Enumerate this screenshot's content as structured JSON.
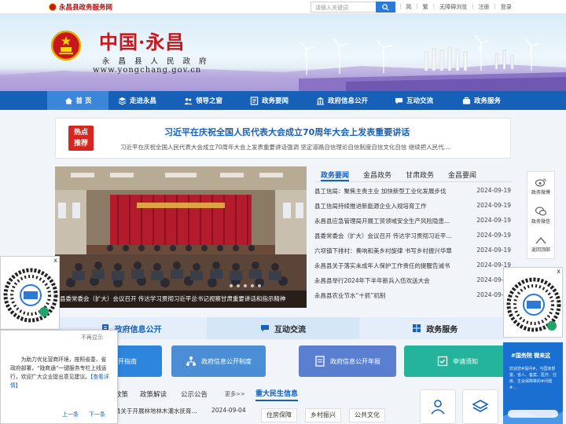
{
  "topbar": {
    "site_name": "永昌县政务服务网",
    "search_placeholder": "请输入关键词",
    "links": [
      "简",
      "繁",
      "无障碍浏览",
      "注册",
      "登录"
    ]
  },
  "banner": {
    "title": "中国·永昌",
    "subtitle": "永 昌 县 人 民 政 府",
    "url": "www.yongchang.gov.cn"
  },
  "nav": {
    "items": [
      {
        "label": "首 页",
        "icon": "home-icon"
      },
      {
        "label": "走进永昌",
        "icon": "layers-icon"
      },
      {
        "label": "领导之窗",
        "icon": "users-icon"
      },
      {
        "label": "政务要闻",
        "icon": "news-icon"
      },
      {
        "label": "政府信息公开",
        "icon": "building-icon"
      },
      {
        "label": "互动交流",
        "icon": "chat-icon"
      },
      {
        "label": "政务服务",
        "icon": "briefcase-icon"
      }
    ]
  },
  "hot": {
    "badge_line1": "热点",
    "badge_line2": "推荐",
    "headline": "习近平在庆祝全国人民代表大会成立70周年大会上发表重要讲话",
    "summary": "习近平在庆祝全国人民代表大会成立70周年大会上发表重要讲话强调 坚定道路自信理论自信制度自信文化自信 继续把人民代..."
  },
  "photo": {
    "caption": "县委常委会（扩大）会议召开 传达学习贯彻习近平总书记视察甘肃重要讲话和指示精神"
  },
  "news": {
    "tabs": [
      "政务要闻",
      "金昌政务",
      "甘肃政务",
      "金昌要闻"
    ],
    "items": [
      {
        "title": "县工信局：聚焦主责主业 加快新型工业化发展步伐",
        "date": "2024-09-19"
      },
      {
        "title": "县工信局持续推进新能源企业入规培育工作",
        "date": "2024-09-19"
      },
      {
        "title": "永昌县应急管理局开展工贸领域安全生产风险隐患...",
        "date": "2024-09-19"
      },
      {
        "title": "县委常委会（扩大）会议召开 传达学习贯彻习近平...",
        "date": "2024-09-19"
      },
      {
        "title": "六坝镇下排村：奏响和美乡村旋律 书写乡村振兴华章",
        "date": "2024-09-19"
      },
      {
        "title": "永昌县关于落实未成年人保护工作责任的提醒告诫书",
        "date": "2024-09-19"
      },
      {
        "title": "永昌县举行2024年下半年新兵入伍欢送大会",
        "date": "2024-09-18"
      },
      {
        "title": "永昌县农业节水“十抓”机制",
        "date": "2024-09-18"
      }
    ]
  },
  "services": {
    "tabs": [
      "政府信息公开",
      "互动交流",
      "政务服务"
    ],
    "tiles": [
      {
        "label": "公开指南",
        "color": "#2d86dc"
      },
      {
        "label": "政府信息公开制度",
        "color": "#4c8ed6"
      },
      {
        "label": "政府信息公开年报",
        "color": "#5a7fd0"
      },
      {
        "label": "申请须知",
        "color": "#24b39b"
      }
    ]
  },
  "bottom": {
    "links": [
      "政策",
      "政策解读",
      "公示公告"
    ],
    "more": "更多>>",
    "minsheng_title": "重大民生信息",
    "pills": [
      "住房保障",
      "乡村振兴",
      "公共文化"
    ],
    "items": [
      {
        "title": "县关于开展林地林木灌水抚育...",
        "date": "2024-09-04"
      }
    ]
  },
  "sidebar": {
    "items": [
      {
        "label": "政务微博",
        "icon": "weibo-icon"
      },
      {
        "label": "政务微信",
        "icon": "wechat-icon"
      },
      {
        "label": "返回顶部",
        "icon": "arrow-up-icon"
      }
    ]
  },
  "notice": {
    "dismiss": "不再显示",
    "text": "为助力优化营商环境，按照省委、省政府部署，“陇商通”一键服务专栏上线运行，欢迎广大企业提出意见建议。",
    "more": "【查看详情】",
    "prev": "上一条",
    "next": "下一条"
  },
  "weibo_card": {
    "title": "#国务院 微来这",
    "body": "欢迎您#提问#，与国家部委、省人、备案、医疗、住房、生会保障等的#问题#..."
  },
  "colors": {
    "nav_blue": "#1660b8",
    "red": "#c8161d",
    "accent": "#2a7ad6"
  }
}
